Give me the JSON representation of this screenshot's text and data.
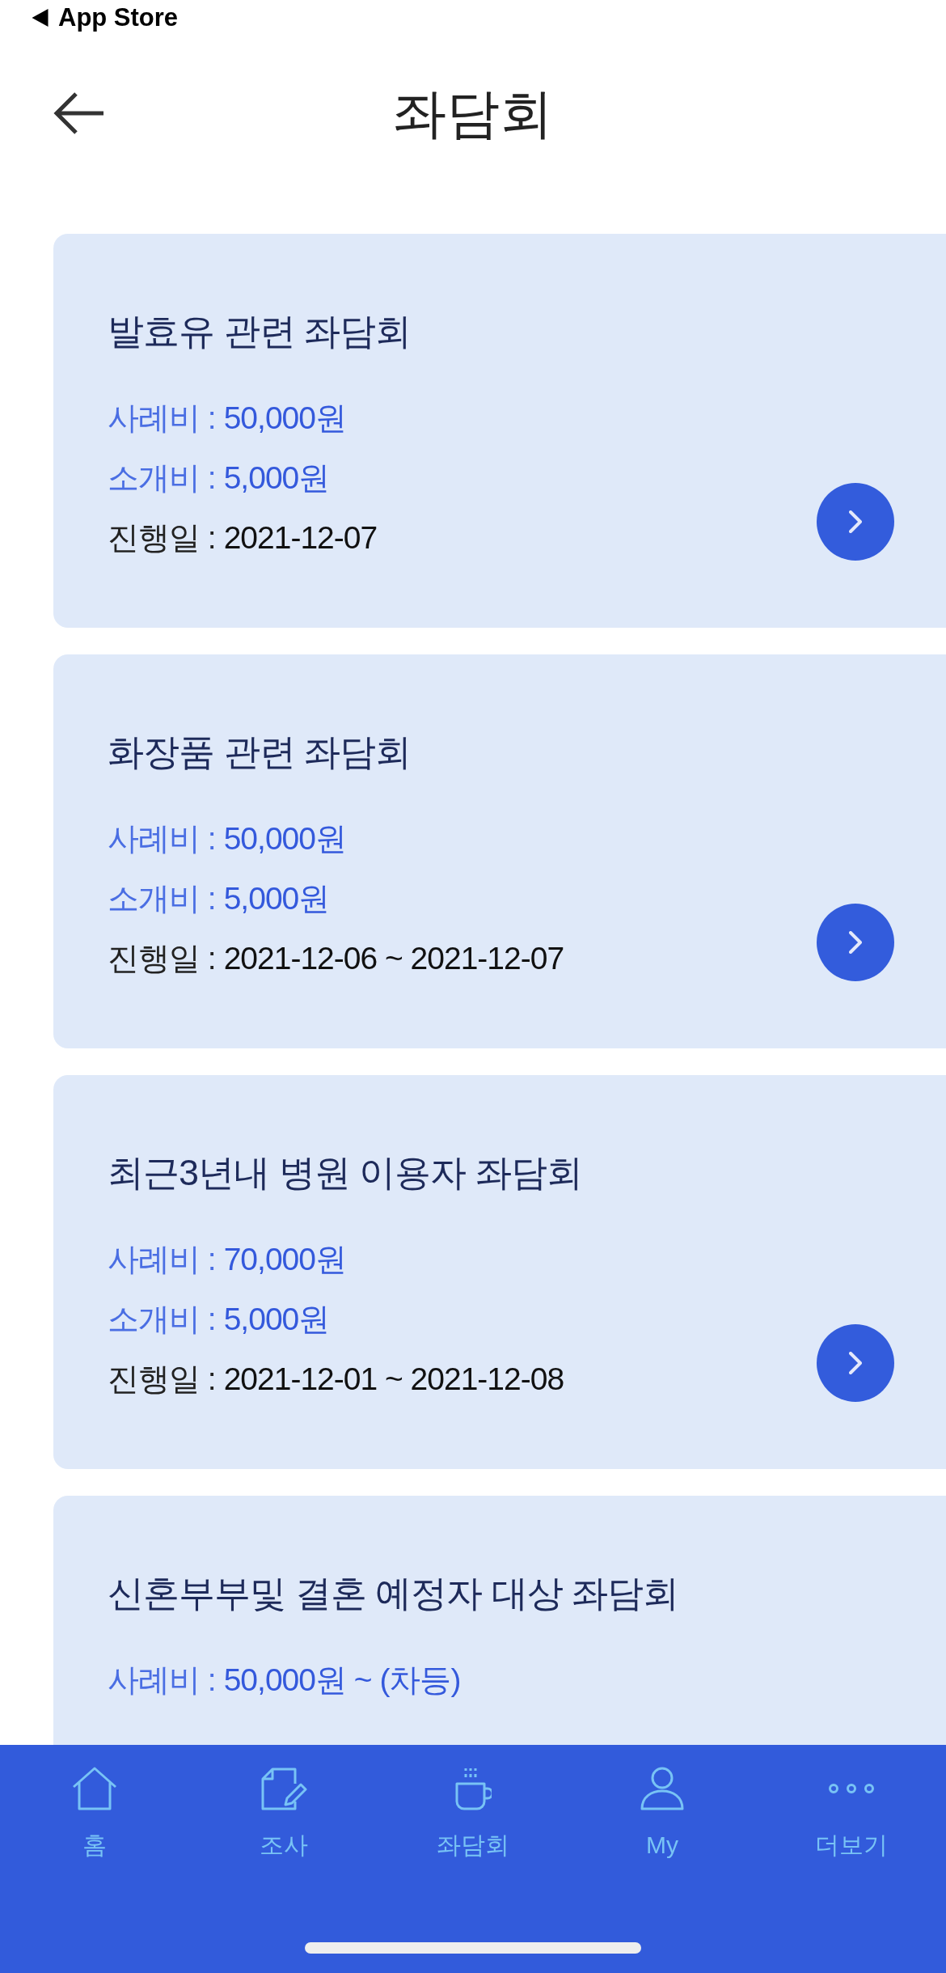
{
  "status_bar": {
    "back_link": "App Store"
  },
  "header": {
    "title": "좌담회"
  },
  "cards": [
    {
      "title": "발효유 관련 좌담회",
      "rows": [
        {
          "kind": "fee",
          "label": "사례비 :",
          "value": "50,000원"
        },
        {
          "kind": "fee",
          "label": "소개비 :",
          "value": "5,000원"
        },
        {
          "kind": "date",
          "label": "진행일 :",
          "value": "2021-12-07"
        }
      ],
      "next_button": true
    },
    {
      "title": "화장품 관련 좌담회",
      "rows": [
        {
          "kind": "fee",
          "label": "사례비 :",
          "value": "50,000원"
        },
        {
          "kind": "fee",
          "label": "소개비 :",
          "value": "5,000원"
        },
        {
          "kind": "date",
          "label": "진행일 :",
          "value": "2021-12-06 ~ 2021-12-07"
        }
      ],
      "next_button": true
    },
    {
      "title": "최근3년내 병원 이용자 좌담회",
      "rows": [
        {
          "kind": "fee",
          "label": "사례비 :",
          "value": "70,000원"
        },
        {
          "kind": "fee",
          "label": "소개비 :",
          "value": "5,000원"
        },
        {
          "kind": "date",
          "label": "진행일 :",
          "value": "2021-12-01 ~ 2021-12-08"
        }
      ],
      "next_button": true
    },
    {
      "title": "신혼부부및 결혼 예정자 대상 좌담회",
      "rows": [
        {
          "kind": "fee",
          "label": "사례비 :",
          "value": "50,000원 ~ (차등)"
        }
      ]
    }
  ],
  "tab_bar": {
    "tabs": [
      {
        "kind": "home",
        "label": "홈",
        "selected": false
      },
      {
        "kind": "survey",
        "label": "조사",
        "selected": false
      },
      {
        "kind": "meeting",
        "label": "좌담회",
        "selected": false
      },
      {
        "kind": "my",
        "label": "My",
        "selected": false
      },
      {
        "kind": "more",
        "label": "더보기",
        "selected": false
      }
    ]
  }
}
